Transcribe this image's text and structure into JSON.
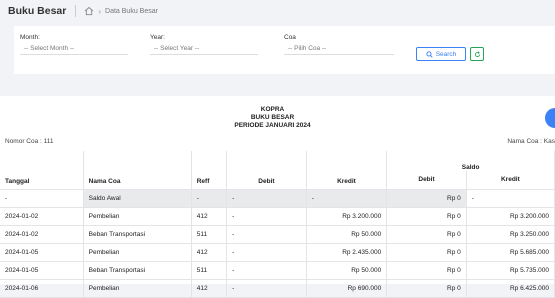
{
  "header": {
    "title": "Buku Besar",
    "breadcrumb": "Data Buku Besar",
    "home_icon": "home-icon",
    "chevron_icon": "chevron-right-icon"
  },
  "filters": {
    "month": {
      "label": "Month:",
      "placeholder": "-- Select Month --"
    },
    "year": {
      "label": "Year:",
      "placeholder": "-- Select Year --"
    },
    "coa": {
      "label": "Coa",
      "placeholder": "-- Pilih Coa --"
    },
    "search_label": "Search",
    "search_icon": "search-icon",
    "refresh_icon": "refresh-icon",
    "colors": {
      "search": "#3b82f6",
      "refresh": "#22a55a"
    }
  },
  "report": {
    "company": "KOPRA",
    "title": "BUKU BESAR",
    "period": "PERIODE JANUARI 2024",
    "nomor_coa": "Nomor Coa : 111",
    "nama_coa": "Nama Coa : Kas"
  },
  "table": {
    "saldo_header": "Saldo",
    "columns": [
      "Tanggal",
      "Nama Coa",
      "Reff",
      "Debit",
      "Kredit",
      "Debit",
      "Kredit"
    ],
    "rows": [
      [
        "-",
        "Saldo Awal",
        "-",
        "-",
        "-",
        "Rp 0",
        "-"
      ],
      [
        "2024-01-02",
        "Pembelian",
        "412",
        "-",
        "Rp 3.200.000",
        "Rp 0",
        "Rp 3.200.000"
      ],
      [
        "2024-01-02",
        "Beban Transportasi",
        "511",
        "-",
        "Rp 50.000",
        "Rp 0",
        "Rp 3.250.000"
      ],
      [
        "2024-01-05",
        "Pembelian",
        "412",
        "-",
        "Rp 2.435.000",
        "Rp 0",
        "Rp 5.685.000"
      ],
      [
        "2024-01-05",
        "Beban Transportasi",
        "511",
        "-",
        "Rp 50.000",
        "Rp 0",
        "Rp 5.735.000"
      ],
      [
        "2024-01-06",
        "Pembelian",
        "412",
        "-",
        "Rp 690.000",
        "Rp 0",
        "Rp 6.425.000"
      ]
    ]
  }
}
